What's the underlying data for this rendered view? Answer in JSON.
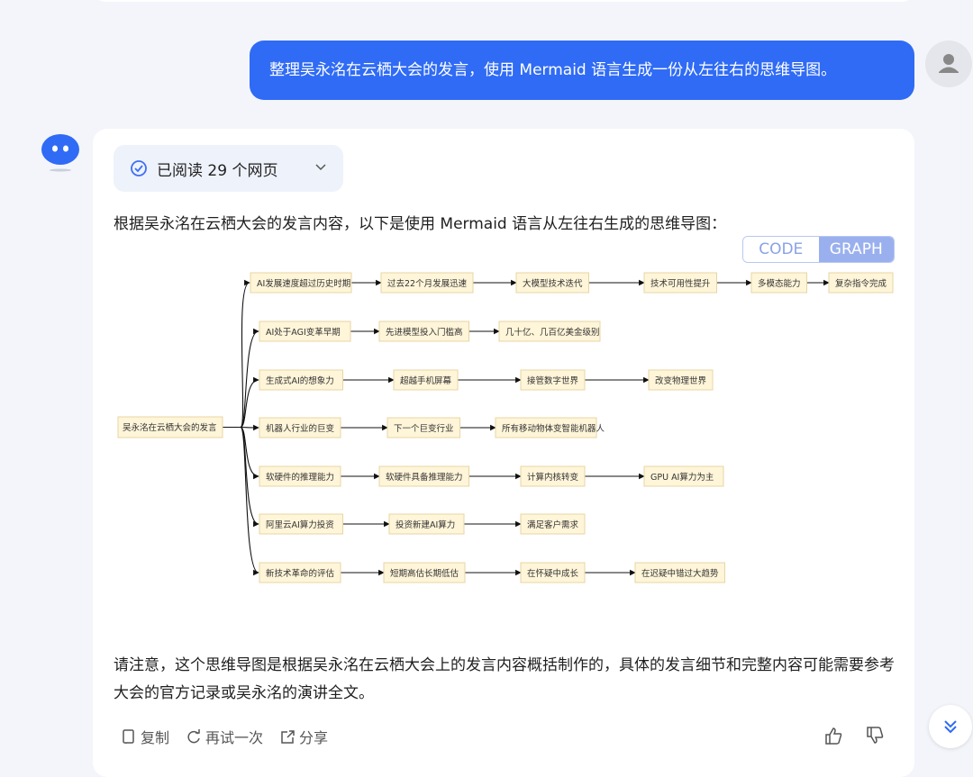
{
  "user_message": "整理吴永洺在云栖大会的发言，使用 Mermaid 语言生成一份从左往右的思维导图。",
  "read_chip": {
    "label": "已阅读 29 个网页"
  },
  "intro": "根据吴永洺在云栖大会的发言内容，以下是使用 Mermaid 语言从左往右生成的思维导图：",
  "view_toggle": {
    "code": "CODE",
    "graph": "GRAPH",
    "active": "GRAPH"
  },
  "mindmap": {
    "root": "吴永洺在云栖大会的发言",
    "branches": [
      [
        "AI发展速度超过历史时期",
        "过去22个月发展迅速",
        "大模型技术迭代",
        "技术可用性提升",
        "多模态能力",
        "复杂指令完成"
      ],
      [
        "AI处于AGI变革早期",
        "先进模型投入门槛高",
        "几十亿、几百亿美金级别"
      ],
      [
        "生成式AI的想象力",
        "超越手机屏幕",
        "接管数字世界",
        "改变物理世界"
      ],
      [
        "机器人行业的巨变",
        "下一个巨变行业",
        "所有移动物体变智能机器人"
      ],
      [
        "软硬件的推理能力",
        "软硬件具备推理能力",
        "计算内核转变",
        "GPU AI算力为主"
      ],
      [
        "阿里云AI算力投资",
        "投资新建AI算力",
        "满足客户需求"
      ],
      [
        "新技术革命的评估",
        "短期高估长期低估",
        "在怀疑中成长",
        "在迟疑中错过大趋势"
      ]
    ]
  },
  "note": "请注意，这个思维导图是根据吴永洺在云栖大会上的发言内容概括制作的，具体的发言细节和完整内容可能需要参考大会的官方记录或吴永洺的演讲全文。",
  "actions": {
    "copy": "复制",
    "retry": "再试一次",
    "share": "分享"
  },
  "colors": {
    "user_bubble": "#2f6bf5",
    "toggle_active": "#9ab0ee",
    "node_fill": "#fff5d9",
    "accent": "#3d6ff5"
  }
}
